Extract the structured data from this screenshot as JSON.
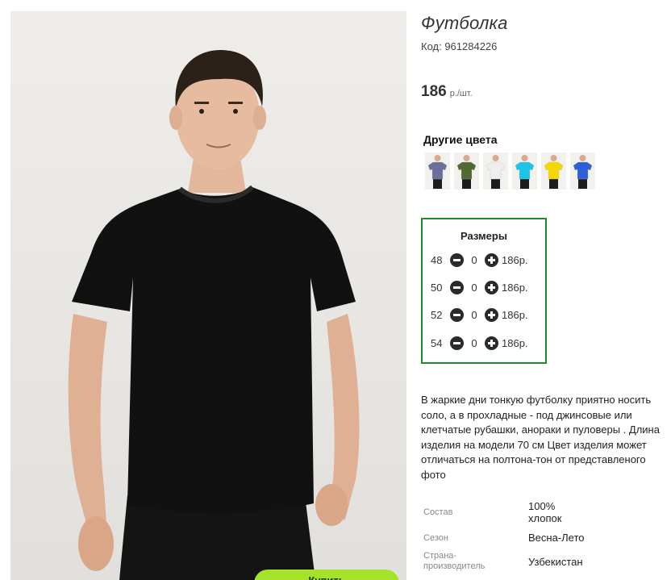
{
  "product": {
    "title": "Футболка",
    "code": "Код: 961284226",
    "price": "186",
    "price_unit": "р./шт."
  },
  "other_colors": {
    "title": "Другие цвета",
    "swatches": [
      {
        "color": "#6c6f9c",
        "icon": "tshirt-swatch"
      },
      {
        "color": "#4f6b33",
        "icon": "tshirt-swatch"
      },
      {
        "color": "#eeeeee",
        "icon": "tshirt-swatch"
      },
      {
        "color": "#1cc5e6",
        "icon": "tshirt-swatch"
      },
      {
        "color": "#f4d800",
        "icon": "tshirt-swatch"
      },
      {
        "color": "#2f5fd6",
        "icon": "tshirt-swatch"
      }
    ]
  },
  "sizes": {
    "title": "Размеры",
    "rows": [
      {
        "size": "48",
        "qty": "0",
        "price": "186р."
      },
      {
        "size": "50",
        "qty": "0",
        "price": "186р."
      },
      {
        "size": "52",
        "qty": "0",
        "price": "186р."
      },
      {
        "size": "54",
        "qty": "0",
        "price": "186р."
      }
    ]
  },
  "description": {
    "lines": [
      "В жаркие дни тонкую футболку приятно носить",
      "соло, а в прохладные - под джинсовые или",
      "клетчатые рубашки, анораки и пуловеры . Длина",
      "изделия на модели 70 см Цвет изделия может",
      "отличаться на полтона-тон от представленого",
      "фото"
    ]
  },
  "specs": [
    {
      "key": "Состав",
      "value_lines": [
        "100%",
        "хлопок"
      ]
    },
    {
      "key": "Сезон",
      "value_lines": [
        "Весна-Лето"
      ]
    },
    {
      "key_lines": [
        "Страна-",
        "производитель"
      ],
      "value_lines": [
        "Узбекистан"
      ]
    }
  ],
  "colors": {
    "accent_border": "#1e8a2a",
    "button": "#a5e32a",
    "shirt": "#111111"
  },
  "buy_button": {
    "label": "Купить"
  }
}
